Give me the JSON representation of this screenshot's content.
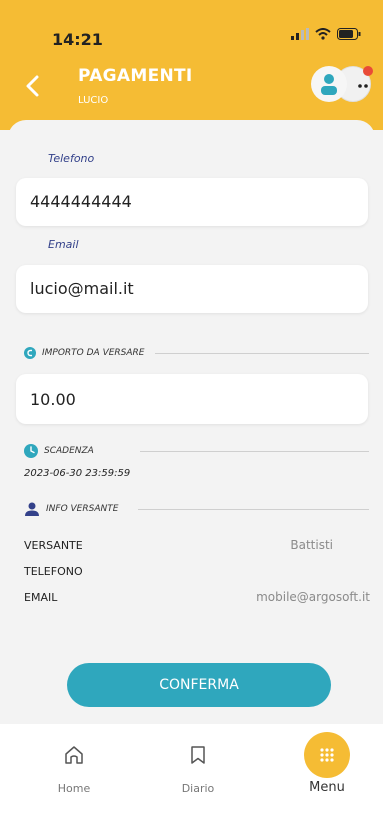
{
  "status": {
    "time": "14:21"
  },
  "header": {
    "title": "PAGAMENTI",
    "subtitle": "LUCIO"
  },
  "form": {
    "phone_label": "Telefono",
    "phone_value": "4444444444",
    "email_label": "Email",
    "email_value": "lucio@mail.it",
    "amount_section": "IMPORTO DA VERSARE",
    "amount_value": "10.00"
  },
  "deadline": {
    "label": "SCADENZA",
    "date": "2023-06-30 23:59:59"
  },
  "payer": {
    "label": "INFO VERSANTE",
    "rows": [
      {
        "label": "VERSANTE",
        "value": "Battisti"
      },
      {
        "label": "TELEFONO",
        "value": ""
      },
      {
        "label": "EMAIL",
        "value": "mobile@argosoft.it"
      }
    ]
  },
  "confirm_label": "CONFERMA",
  "tabs": {
    "home": "Home",
    "diary": "Diario",
    "menu": "Menu"
  },
  "colors": {
    "accent": "#f5bc34",
    "button": "#2fa7bd",
    "label": "#33418a"
  }
}
